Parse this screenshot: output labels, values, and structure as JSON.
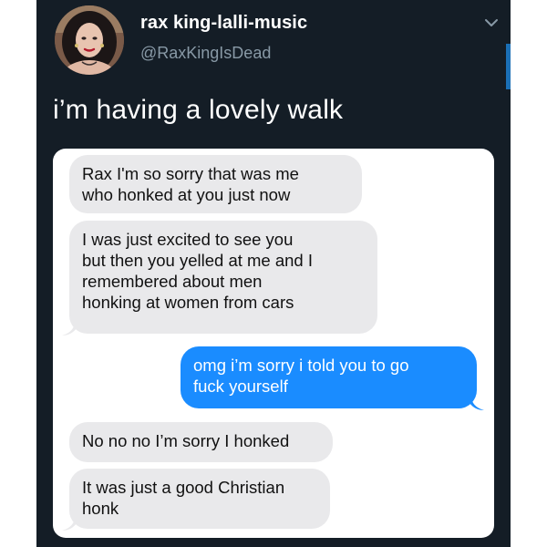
{
  "tweet": {
    "display_name": "rax king-lalli-music",
    "handle": "@RaxKingIsDead",
    "text": "i’m having a lovely walk",
    "menu_icon": "chevron-down-icon"
  },
  "conversation": {
    "messages": [
      {
        "direction": "incoming",
        "lines": [
          "Rax I'm so sorry that was me",
          "who honked at you just now"
        ]
      },
      {
        "direction": "incoming",
        "lines": [
          "I was just excited to see you",
          "but then you yelled at me and I",
          "remembered about men",
          "honking at women from cars"
        ]
      },
      {
        "direction": "outgoing",
        "lines": [
          "omg i’m sorry i told you to go",
          "fuck yourself"
        ]
      },
      {
        "direction": "incoming",
        "lines": [
          "No no no I’m sorry I honked"
        ]
      },
      {
        "direction": "incoming",
        "lines": [
          "It was just a good Christian",
          "honk"
        ]
      }
    ]
  },
  "colors": {
    "background": "#141d26",
    "handle": "#8899a6",
    "incoming_bubble": "#e9e9eb",
    "outgoing_bubble": "#1a8cff"
  }
}
